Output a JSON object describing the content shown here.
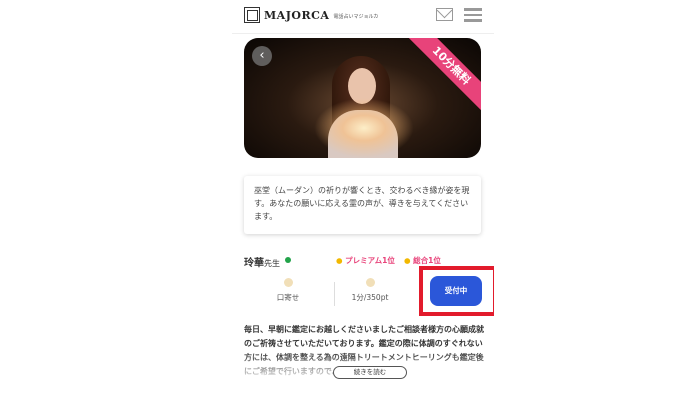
{
  "header": {
    "logo_text": "MAJORCA",
    "logo_sub": "電話占いマジョルカ"
  },
  "hero": {
    "ribbon": "10分無料",
    "back_glyph": "‹"
  },
  "description": "巫堂（ムーダン）の祈りが響くとき、交わるべき縁が姿を現す。あなたの願いに応える霊の声が、導きを与えてくださいます。",
  "advisor": {
    "name": "玲華",
    "suffix": "先生",
    "rank_premium": "プレミアム1位",
    "rank_overall": "総合1位"
  },
  "stats": {
    "style": "口寄せ",
    "price": "1分/350pt"
  },
  "status_button": "受付中",
  "bio": "毎日、早朝に鑑定にお越しくださいましたご相談者様方の心願成就のご祈祷させていただいております。鑑定の際に体調のすぐれない方には、体調を整える為の遠隔トリートメントヒーリングも鑑定後にご希望で行いますので、お気軽に。",
  "more_button": "続きを読む",
  "colors": {
    "accent_pink": "#e8437a",
    "status_blue": "#2b57d9",
    "highlight_red": "#e21b2c",
    "online_green": "#22a34a"
  },
  "icons": [
    "logo-mark-icon",
    "mail-icon",
    "menu-icon",
    "back-arrow-icon",
    "online-status-icon",
    "rank-bulb-icon",
    "style-icon",
    "price-icon"
  ]
}
